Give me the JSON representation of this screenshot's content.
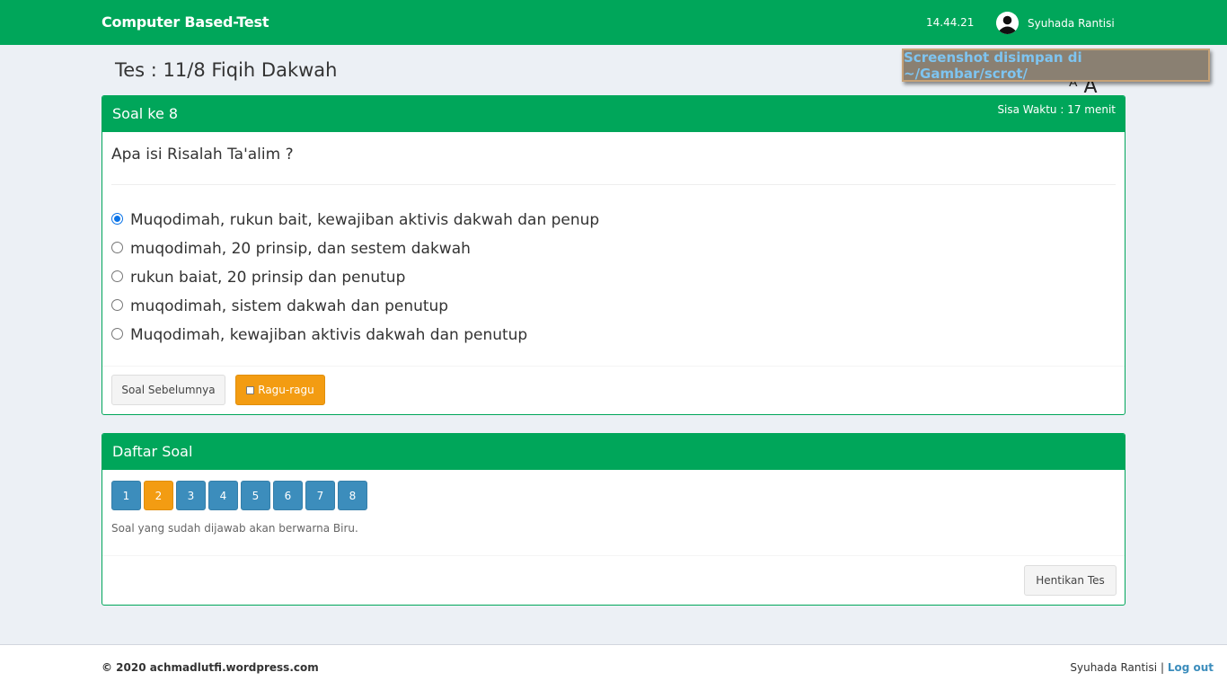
{
  "header": {
    "brand": "Computer Based-Test",
    "time": "14.44.21",
    "user_name": "Syuhada Rantisi",
    "bg_color": "#00a65a"
  },
  "page": {
    "title": "Tes : 11/8 Fiqih Dakwah"
  },
  "toast": {
    "message": "Screenshot disimpan di ~/Gambar/scrot/"
  },
  "question_box": {
    "title": "Soal ke 8",
    "timer": "Sisa Waktu : 17 menit",
    "question": "Apa isi Risalah Ta'alim ?",
    "options": [
      {
        "label": "Muqodimah, rukun bait, kewajiban aktivis dakwah dan penup",
        "selected": true
      },
      {
        "label": "muqodimah, 20 prinsip, dan sestem dakwah",
        "selected": false
      },
      {
        "label": "rukun baiat, 20 prinsip dan penutup",
        "selected": false
      },
      {
        "label": "muqodimah, sistem dakwah dan penutup",
        "selected": false
      },
      {
        "label": "Muqodimah, kewajiban aktivis dakwah dan penutup",
        "selected": false
      }
    ],
    "prev_button": "Soal Sebelumnya",
    "doubt_button": "Ragu-ragu"
  },
  "list_box": {
    "title": "Daftar Soal",
    "numbers": [
      "1",
      "2",
      "3",
      "4",
      "5",
      "6",
      "7",
      "8"
    ],
    "active_number": "2",
    "hint": "Soal yang sudah dijawab akan berwarna Biru.",
    "stop_button": "Hentikan Tes"
  },
  "footer": {
    "copyright": "© 2020 achmadlutfi.wordpress.com",
    "user_name": "Syuhada Rantisi",
    "separator": "|",
    "logout": "Log out"
  }
}
